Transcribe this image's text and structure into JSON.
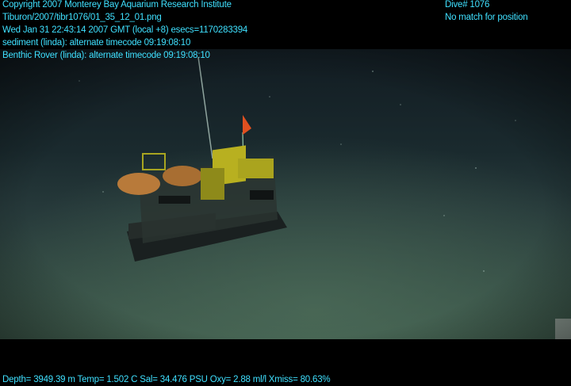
{
  "header_left": {
    "line1": "Copyright 2007 Monterey Bay Aquarium Research Institute",
    "line2": "Tiburon/2007/tibr1076/01_35_12_01.png",
    "line3": "Wed Jan 31 22:43:14 2007 GMT (local +8)  esecs=1170283394",
    "line4": "sediment (linda): alternate timecode 09:19:08:10",
    "line5": "Benthic Rover (linda): alternate timecode 09:19:08:10"
  },
  "header_right": {
    "dive": "Dive# 1076",
    "position_status": "No match for position"
  },
  "footer": {
    "telemetry": "Depth= 3949.39 m  Temp= 1.502 C  Sal= 34.476 PSU  Oxy= 2.88 ml/l  Xmiss= 80.63%"
  },
  "colors": {
    "overlay_text": "#3fe0ff",
    "water": "#18282c",
    "seafloor": "#3d5a4e",
    "rover_yellow": "#b8b020",
    "float_orange": "#b87a3a",
    "flag": "#e05020"
  }
}
